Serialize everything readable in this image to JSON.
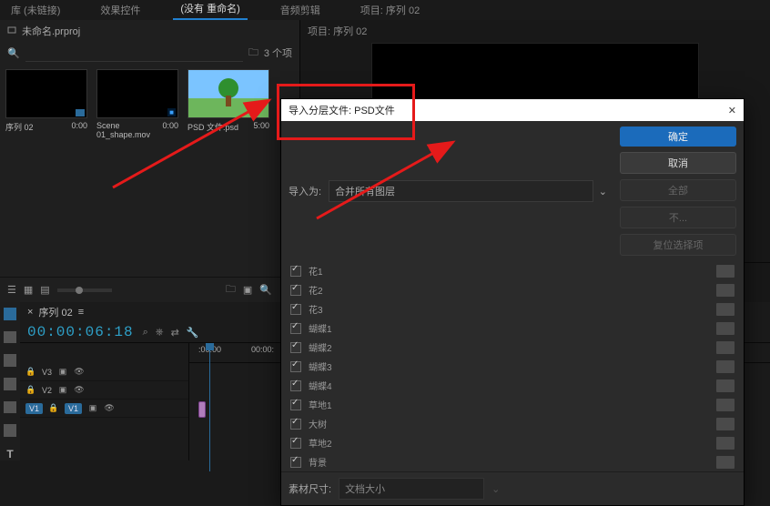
{
  "colors": {
    "accent": "#2a6b9b",
    "primaryBtn": "#1b6bbb",
    "red": "#e51a1a"
  },
  "topTabs": [
    "库 (未链接)",
    "效果控件",
    "(没有 重命名)",
    "音频剪辑",
    "项目: 序列 02"
  ],
  "project": {
    "name": "未命名.prproj",
    "searchPlaceholder": "",
    "itemCount": "3 个项",
    "items": [
      {
        "name": "序列 02",
        "dur": "0:00",
        "thumb": "black"
      },
      {
        "name": "Scene 01_shape.mov",
        "dur": "0:00",
        "thumb": "black"
      },
      {
        "name": "PSD 文件.psd",
        "dur": "5:00",
        "thumb": "tree"
      }
    ]
  },
  "programHeader": "项目: 序列 02",
  "timeline": {
    "tab": "序列 02",
    "timecode": "00:00:06:18",
    "rulerTicks": [
      {
        "t": ":00:00",
        "x": 10
      },
      {
        "t": "00:00:",
        "x": 68
      }
    ],
    "tracks": [
      {
        "chip": "",
        "id": "V3",
        "eye": true
      },
      {
        "chip": "",
        "id": "V2",
        "eye": true
      },
      {
        "chip": "V1",
        "id": "V1",
        "eye": true
      }
    ]
  },
  "dialog": {
    "title": "导入分层文件: PSD文件",
    "importAsLabel": "导入为:",
    "importAsValue": "合并所有图层",
    "buttons": {
      "ok": "确定",
      "cancel": "取消",
      "all": "全部",
      "none": "不...",
      "reset": "复位选择项"
    },
    "layers": [
      {
        "name": "花1",
        "on": true
      },
      {
        "name": "花2",
        "on": true
      },
      {
        "name": "花3",
        "on": true
      },
      {
        "name": "蝴蝶1",
        "on": true
      },
      {
        "name": "蝴蝶2",
        "on": true
      },
      {
        "name": "蝴蝶3",
        "on": true
      },
      {
        "name": "蝴蝶4",
        "on": true
      },
      {
        "name": "草地1",
        "on": true
      },
      {
        "name": "大树",
        "on": true
      },
      {
        "name": "草地2",
        "on": true
      },
      {
        "name": "背景",
        "on": true
      }
    ],
    "footerLabel": "素材尺寸:",
    "footerValue": "文档大小"
  }
}
